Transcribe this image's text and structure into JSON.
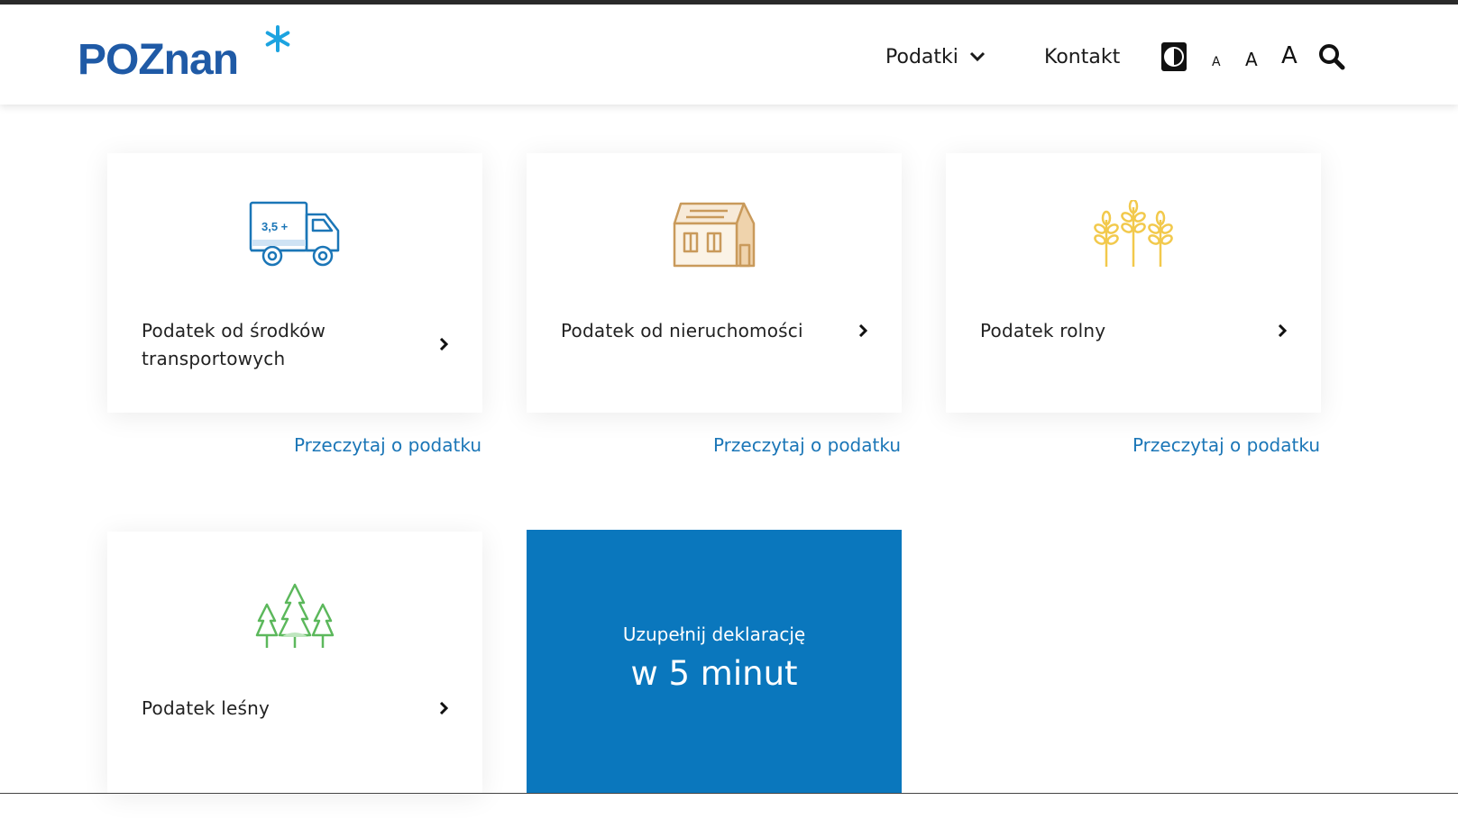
{
  "brand": {
    "logo_text": "POZnan",
    "logo_color": "#1f5aa6",
    "star_color": "#1ca3e0"
  },
  "header": {
    "nav": {
      "podatki_label": "Podatki",
      "kontakt_label": "Kontakt"
    },
    "accessibility": {
      "font_small": "A",
      "font_medium": "A",
      "font_large": "A"
    },
    "icons": [
      "chevron-down-icon",
      "contrast-icon",
      "search-icon"
    ]
  },
  "cards": [
    {
      "title": "Podatek od środków transportowych",
      "link": "Przeczytaj o podatku",
      "icon": "truck-icon",
      "icon_label": "3,5 +",
      "color": "#1b76b7"
    },
    {
      "title": "Podatek od nieruchomości",
      "link": "Przeczytaj o podatku",
      "icon": "house-icon",
      "color": "#d4a56a"
    },
    {
      "title": "Podatek rolny",
      "link": "Przeczytaj o podatku",
      "icon": "wheat-icon",
      "color": "#f2c94c"
    },
    {
      "title": "Podatek leśny",
      "icon": "trees-icon",
      "color": "#5cb85c"
    }
  ],
  "cta": {
    "line1": "Uzupełnij deklarację",
    "line2": "w 5 minut",
    "background": "#0a77bd"
  }
}
